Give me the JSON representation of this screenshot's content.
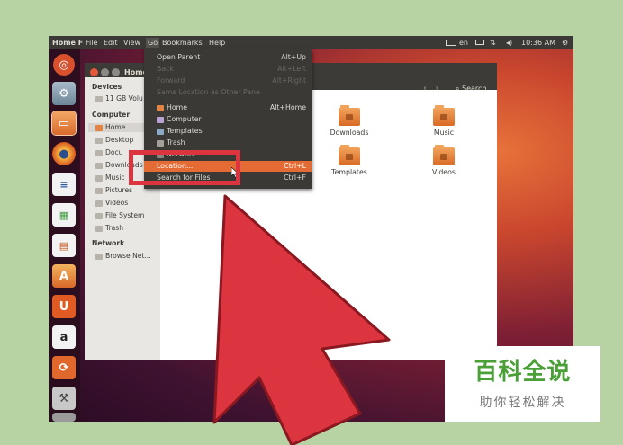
{
  "top_panel": {
    "app_name": "Home F",
    "menus": [
      "File",
      "Edit",
      "View",
      "Go",
      "Bookmarks",
      "Help"
    ],
    "keyboard_layout": "en",
    "time": "10:36 AM"
  },
  "launcher": {
    "icons": [
      "dash-home",
      "system-settings",
      "files",
      "firefox",
      "libreoffice-writer",
      "libreoffice-calc",
      "libreoffice-impress",
      "software-center",
      "ubuntu-one",
      "amazon",
      "update-manager",
      "system-tools",
      "trash"
    ]
  },
  "window": {
    "title": "Home",
    "search_label": "Search"
  },
  "sidebar": {
    "devices_header": "Devices",
    "devices": [
      "11 GB Volu"
    ],
    "computer_header": "Computer",
    "computer": [
      "Home",
      "Desktop",
      "Docu",
      "Downloads",
      "Music",
      "Pictures",
      "Videos",
      "File System",
      "Trash"
    ],
    "network_header": "Network",
    "network": [
      "Browse Net..."
    ]
  },
  "content": {
    "folders": [
      "Downloads",
      "Music",
      "Templates",
      "Videos"
    ]
  },
  "go_menu": {
    "items": [
      {
        "label": "Open Parent",
        "shortcut": "Alt+Up",
        "disabled": false
      },
      {
        "label": "Back",
        "shortcut": "Alt+Left",
        "disabled": true
      },
      {
        "label": "Forward",
        "shortcut": "Alt+Right",
        "disabled": true
      },
      {
        "label": "Same Location as Other Pane",
        "shortcut": "",
        "disabled": true
      },
      {
        "label": "Home",
        "shortcut": "Alt+Home",
        "disabled": false
      },
      {
        "label": "Computer",
        "shortcut": "",
        "disabled": false
      },
      {
        "label": "Templates",
        "shortcut": "",
        "disabled": false
      },
      {
        "label": "Trash",
        "shortcut": "",
        "disabled": false
      },
      {
        "label": "Network",
        "shortcut": "",
        "disabled": false
      },
      {
        "label": "Location...",
        "shortcut": "Ctrl+L",
        "disabled": false
      },
      {
        "label": "Search for Files",
        "shortcut": "Ctrl+F",
        "disabled": false
      }
    ],
    "highlighted": "Location..."
  },
  "watermark": {
    "title": "百科全说",
    "subtitle": "助你轻松解决"
  },
  "colors": {
    "highlight": "#e56b34",
    "annotation_red": "#dc3540",
    "watermark_green": "#4aa036"
  }
}
